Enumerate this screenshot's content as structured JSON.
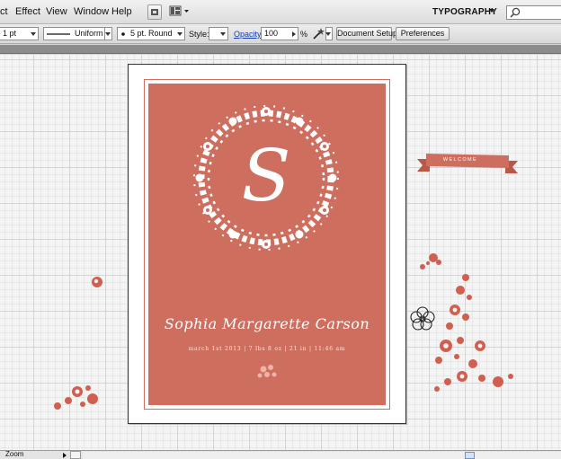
{
  "menubar": {
    "items": [
      "ct",
      "Effect",
      "View",
      "Window",
      "Help"
    ],
    "workspace": "TYPOGRAPHY"
  },
  "controlbar": {
    "stroke_weight": "1 pt",
    "profile": "Uniform",
    "brush": "5 pt. Round",
    "style_label": "Style:",
    "opacity_label": "Opacity:",
    "opacity_value": "100",
    "percent": "%",
    "document_setup": "Document Setup",
    "preferences": "Preferences"
  },
  "artwork": {
    "monogram": "S",
    "name": "Sophia Margarette Carson",
    "details": "march 1st 2013  |  7 lbs 8 oz  |  21 in  |  11:46 am",
    "ribbon": "WELCOME"
  },
  "statusbar": {
    "zoom": "Zoom"
  },
  "colors": {
    "card": "#cd6e5f",
    "accent": "#d05f4f"
  }
}
